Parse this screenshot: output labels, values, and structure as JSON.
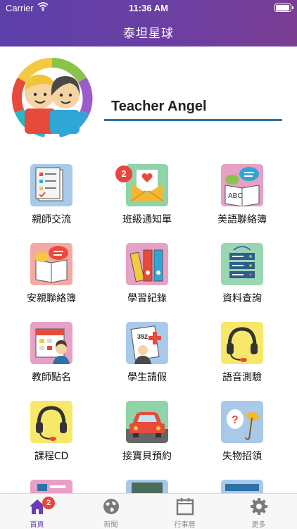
{
  "status_bar": {
    "carrier": "Carrier",
    "time": "11:36 AM",
    "icons": [
      "wifi-icon",
      "battery-icon"
    ]
  },
  "nav": {
    "title": "泰坦星球"
  },
  "profile": {
    "name": "Teacher Angel",
    "avatar_icon": "teachers-avatar-icon"
  },
  "colors": {
    "nav_purple": "#6b3fa3",
    "accent_blue": "#2e72a8",
    "badge_red": "#e8453c",
    "tab_active": "#6a3fb0"
  },
  "grid": {
    "tiles": [
      {
        "label": "親師交流",
        "icon": "checklist-icon"
      },
      {
        "label": "班級通知單",
        "icon": "envelope-heart-icon",
        "badge": "2"
      },
      {
        "label": "美語聯絡簿",
        "icon": "chat-book-icon"
      },
      {
        "label": "安親聯絡簿",
        "icon": "chat-notebook-icon"
      },
      {
        "label": "學習紀錄",
        "icon": "binders-icon"
      },
      {
        "label": "資料查詢",
        "icon": "server-icon"
      },
      {
        "label": "教師點名",
        "icon": "calendar-teacher-icon"
      },
      {
        "label": "學生請假",
        "icon": "medical-note-icon"
      },
      {
        "label": "語音測驗",
        "icon": "headset-icon"
      },
      {
        "label": "課程CD",
        "icon": "headset-icon"
      },
      {
        "label": "接寶貝預約",
        "icon": "car-icon"
      },
      {
        "label": "失物招領",
        "icon": "lost-umbrella-icon"
      }
    ]
  },
  "tab_bar": {
    "tabs": [
      {
        "label": "首頁",
        "icon": "home-icon",
        "badge": "2",
        "active": true
      },
      {
        "label": "新聞",
        "icon": "globe-icon"
      },
      {
        "label": "行事曆",
        "icon": "calendar-icon"
      },
      {
        "label": "更多",
        "icon": "gear-icon"
      }
    ]
  }
}
